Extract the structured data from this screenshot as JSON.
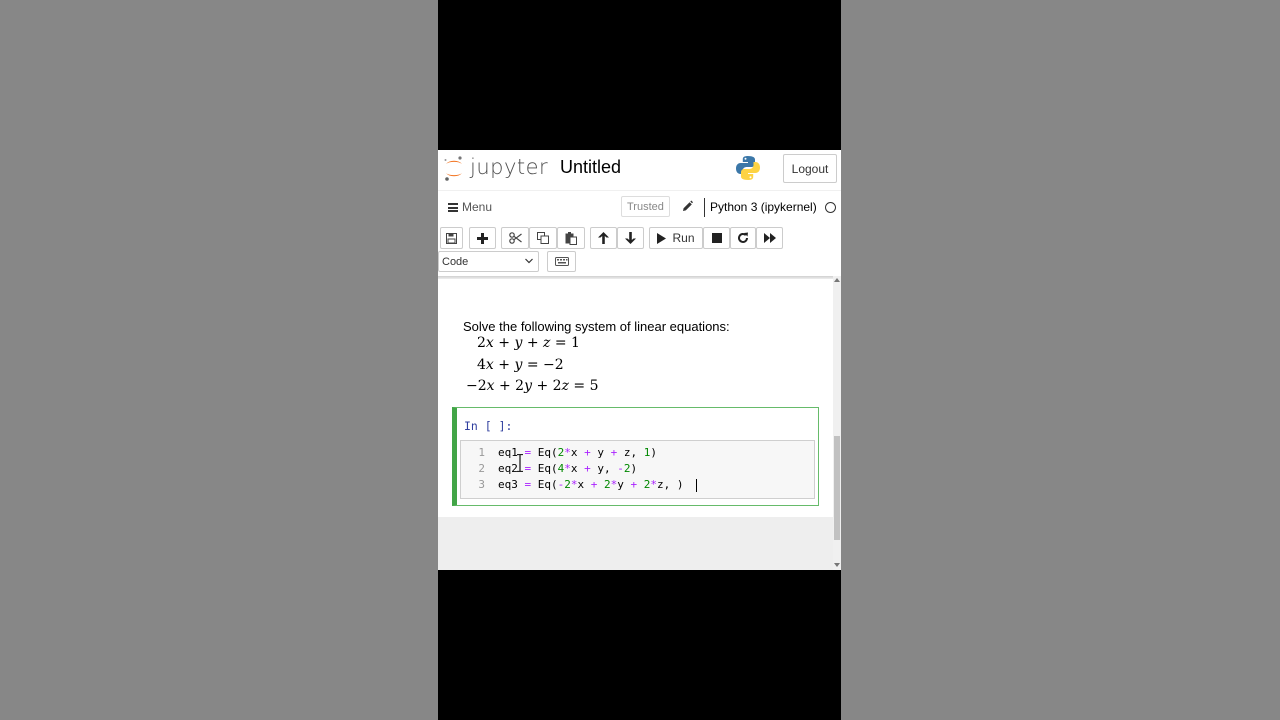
{
  "header": {
    "logo_text": "jupyter",
    "notebook_title": "Untitled",
    "logout_label": "Logout"
  },
  "menubar": {
    "menu_label": "Menu",
    "trusted_label": "Trusted",
    "kernel_name": "Python 3 (ipykernel)"
  },
  "toolbar": {
    "run_label": "Run",
    "cell_type": "Code",
    "buttons": [
      "save-icon",
      "plus-icon",
      "scissors-icon",
      "copy-icon",
      "paste-icon",
      "arrow-up-icon",
      "arrow-down-icon",
      "play-icon",
      "stop-icon",
      "restart-icon",
      "fast-forward-icon",
      "keyboard-icon"
    ]
  },
  "markdown": {
    "intro": "Solve the following system of linear equations:",
    "equations": [
      "2x + y + z = 1",
      "4x + y = −2",
      "−2x + 2y + 2z = 5"
    ]
  },
  "code_cell": {
    "prompt": "In [ ]:",
    "lines": [
      {
        "num": "1",
        "text": "eq1 = Eq(2*x + y + z, 1)"
      },
      {
        "num": "2",
        "text": "eq2 = Eq(4*x + y, -2)"
      },
      {
        "num": "3",
        "text": "eq3 = Eq(-2*x + 2*y + 2*z, )"
      }
    ]
  },
  "colors": {
    "jupyter_orange": "#f37726",
    "cell_border_green": "#42a547",
    "prompt_blue": "#303f9f",
    "operator_purple": "#aa22ff",
    "number_green": "#008800"
  }
}
